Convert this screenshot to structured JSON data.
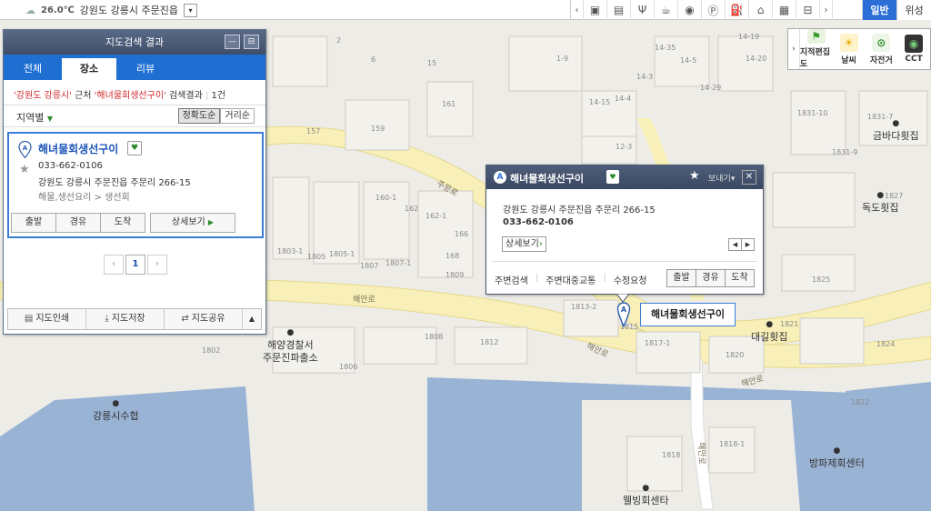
{
  "topbar": {
    "temperature": "26.0℃",
    "location": "강원도 강릉시 주문진읍",
    "dropdown_symbol": "▾",
    "map_types": [
      "일반",
      "위성"
    ],
    "active_map_type": "일반"
  },
  "tools": {
    "items": [
      {
        "label": "지적편집도",
        "icon": "flag-icon"
      },
      {
        "label": "날씨",
        "icon": "weather-icon"
      },
      {
        "label": "자전거",
        "icon": "bicycle-icon"
      },
      {
        "label": "CCT",
        "icon": "cctv-icon"
      }
    ]
  },
  "panel": {
    "title": "지도검색 결과",
    "tabs": [
      {
        "label": "전체",
        "active": false
      },
      {
        "label": "장소",
        "active": true
      },
      {
        "label": "리뷰",
        "active": false
      }
    ],
    "result_info": {
      "region": "'강원도 강릉시'",
      "near": "근처",
      "query": "'해녀물회생선구이'",
      "suffix": "검색결과",
      "count": "1건"
    },
    "region_filter": "지역별",
    "sort_buttons": [
      "정확도순",
      "거리순"
    ],
    "result": {
      "marker_letter": "A",
      "name": "해녀물회생선구이",
      "phone": "033-662-0106",
      "address": "강원도 강릉시 주문진읍 주문리 266-15",
      "category": "해물,생선요리 > 생선회",
      "actions": [
        "출발",
        "경유",
        "도착"
      ],
      "detail_label": "상세보기"
    },
    "pager": {
      "current": "1"
    },
    "footer": [
      "지도인쇄",
      "지도저장",
      "지도공유"
    ]
  },
  "popup": {
    "marker_letter": "A",
    "name": "해녀물회생선구이",
    "send_label": "보내기",
    "address": "강원도 강릉시 주문진읍 주문리 266-15",
    "phone": "033-662-0106",
    "detail_label": "상세보기",
    "links": [
      "주변검색",
      "주변대중교통",
      "수정요청"
    ],
    "actions": [
      "출발",
      "경유",
      "도착"
    ]
  },
  "map_label": "해녀물회생선구이",
  "map": {
    "pois": [
      {
        "name": "금바다횟집"
      },
      {
        "name": "독도횟집"
      },
      {
        "name": "대길횟집"
      },
      {
        "name": "해양경찰서\n주문진파출소"
      },
      {
        "name": "강릉시수협"
      },
      {
        "name": "방파제회센터"
      },
      {
        "name": "웰빙회센타"
      }
    ],
    "road_labels": [
      "해안로",
      "해안로",
      "해안로",
      "주문로",
      "해안로"
    ],
    "parcels": [
      "161",
      "157",
      "159",
      "160-1",
      "162",
      "162-1",
      "166",
      "1803-1",
      "1805",
      "1805-1",
      "1807",
      "1807-1",
      "168",
      "1809",
      "1802",
      "1806",
      "1808",
      "1812",
      "1813-2",
      "1815",
      "1817-1",
      "1818",
      "1818-1",
      "1820",
      "1821",
      "1822",
      "1824",
      "1825",
      "1827",
      "1831-7",
      "1831-9",
      "1831-10",
      "14-35",
      "14-5",
      "14-29",
      "14-3",
      "14-15",
      "14-4",
      "12-3",
      "1-9",
      "2",
      "6",
      "14-19",
      "14-20",
      "15"
    ]
  }
}
